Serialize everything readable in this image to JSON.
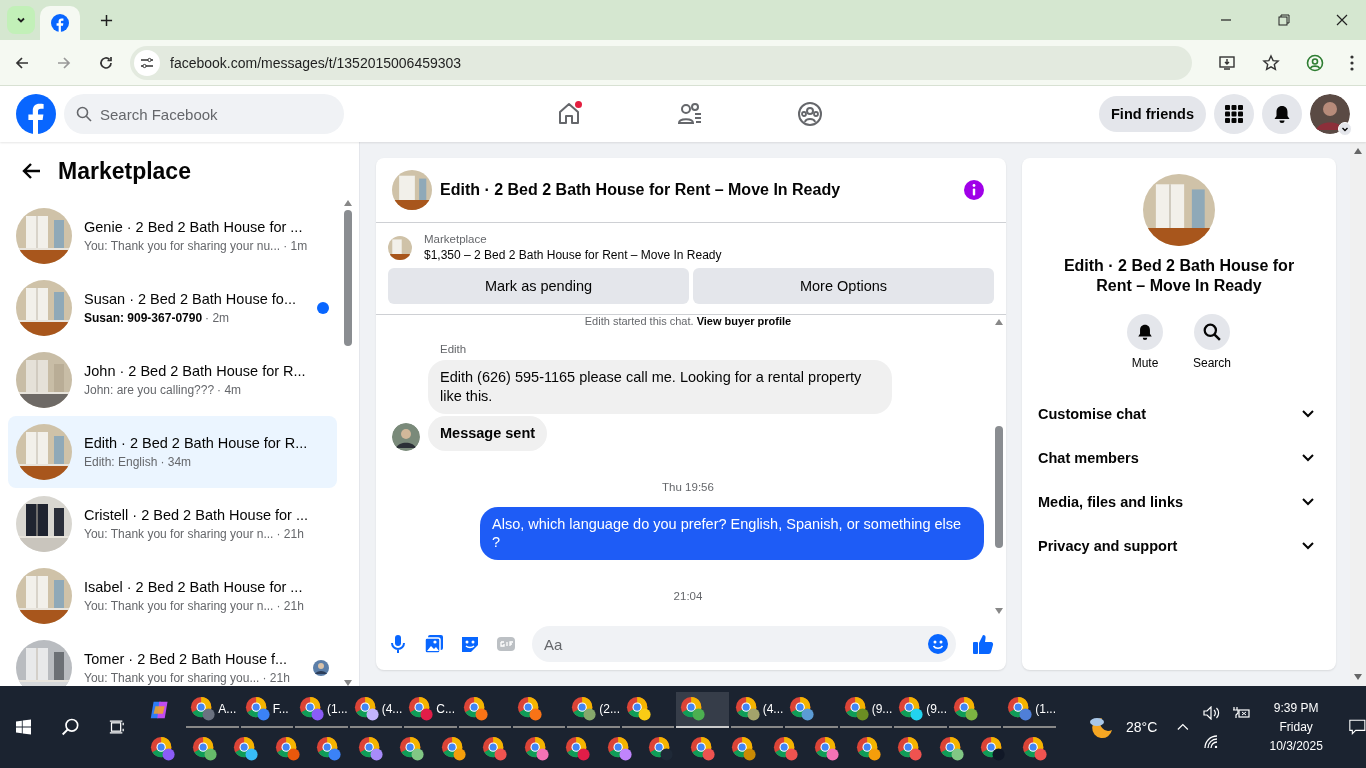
{
  "browser": {
    "address": "facebook.com/messages/t/1352015006459303"
  },
  "header": {
    "search": {
      "placeholder": "Search Facebook"
    },
    "find_friends": "Find friends"
  },
  "sidebar": {
    "title": "Marketplace",
    "conversations": [
      {
        "name": "Genie · 2 Bed 2 Bath House for ...",
        "preview": "You: Thank you for sharing your nu...",
        "time": "· 1m",
        "unread": false,
        "selected": false,
        "seen": false
      },
      {
        "name": "Susan · 2 Bed 2 Bath House fo...",
        "preview": "Susan: 909-367-0790",
        "time": "· 2m",
        "unread": true,
        "selected": false,
        "seen": false
      },
      {
        "name": "John · 2 Bed 2 Bath House for R...",
        "preview": "John: are you calling???",
        "time": "· 4m",
        "unread": false,
        "selected": false,
        "seen": false
      },
      {
        "name": "Edith · 2 Bed 2 Bath House for R...",
        "preview": "Edith: English",
        "time": "· 34m",
        "unread": false,
        "selected": true,
        "seen": false
      },
      {
        "name": "Cristell · 2 Bed 2 Bath House for ...",
        "preview": "You: Thank you for sharing your n...",
        "time": "· 21h",
        "unread": false,
        "selected": false,
        "seen": false
      },
      {
        "name": "Isabel · 2 Bed 2 Bath House for ...",
        "preview": "You: Thank you for sharing your n...",
        "time": "· 21h",
        "unread": false,
        "selected": false,
        "seen": false
      },
      {
        "name": "Tomer · 2 Bed 2 Bath House f...",
        "preview": "You: Thank you for sharing you...",
        "time": "· 21h",
        "unread": false,
        "selected": false,
        "seen": true
      }
    ]
  },
  "chat": {
    "title": "Edith · 2 Bed 2 Bath House for Rent – Move In Ready",
    "listing": {
      "label": "Marketplace",
      "text": "$1,350 – 2 Bed 2 Bath House for Rent – Move In Ready"
    },
    "buttons": [
      "Mark as pending",
      "More Options"
    ],
    "notice": {
      "text": "Edith started this chat.",
      "link": "View buyer profile"
    },
    "messages": [
      {
        "kind": "sender",
        "text": "Edith"
      },
      {
        "kind": "incoming",
        "text": "Edith (626) 595-1165 please call me. Looking for a rental property like this.",
        "bold": false,
        "avatar": false
      },
      {
        "kind": "incoming",
        "text": "Message sent",
        "bold": true,
        "avatar": true
      },
      {
        "kind": "time",
        "text": "Thu 19:56"
      },
      {
        "kind": "outgoing",
        "text": "Also, which language do you prefer? English, Spanish, or something else ?"
      },
      {
        "kind": "time",
        "text": "21:04"
      }
    ],
    "composer": {
      "placeholder": "Aa"
    }
  },
  "info": {
    "title": "Edith · 2 Bed 2 Bath House for Rent – Move In Ready",
    "actions": [
      {
        "kind": "mute",
        "label": "Mute"
      },
      {
        "kind": "search",
        "label": "Search"
      }
    ],
    "sections": [
      {
        "label": "Customise chat",
        "expanded": false
      },
      {
        "label": "Chat members",
        "expanded": false
      },
      {
        "label": "Media, files and links",
        "expanded": false
      },
      {
        "label": "Privacy and support",
        "expanded": false
      }
    ]
  },
  "taskbar": {
    "open_apps": [
      {
        "label": "A...",
        "color": "#6b7280",
        "active": false
      },
      {
        "label": "F...",
        "color": "#3b82f6",
        "active": false
      },
      {
        "label": "(1...",
        "color": "#8b5cf6",
        "active": false
      },
      {
        "label": "(4...",
        "color": "#c4b5fd",
        "active": false
      },
      {
        "label": "C...",
        "color": "#e11d48",
        "active": false
      },
      {
        "color": "#f97316",
        "active": false
      },
      {
        "color": "#f97316",
        "active": false
      },
      {
        "label": "(2...",
        "color": "#86a86b",
        "active": false
      },
      {
        "color": "#facc15",
        "active": false
      },
      {
        "color": "#4caf50",
        "active": true
      },
      {
        "label": "(4...",
        "color": "#a3a36b",
        "active": false
      },
      {
        "color": "#5b9bd5",
        "active": false
      },
      {
        "label": "(9...",
        "color": "#6b8e23",
        "active": false
      },
      {
        "label": "(9...",
        "color": "#22d3ee",
        "active": false
      },
      {
        "color": "#7cb342",
        "active": false
      },
      {
        "label": "(1...",
        "color": "#4f7fd8",
        "active": false
      }
    ],
    "pinned": [
      {
        "color": "#8b5cf6"
      },
      {
        "color": "#66bb6a"
      },
      {
        "color": "#38bdf8"
      },
      {
        "color": "#ea580c"
      },
      {
        "color": "#3b82f6"
      },
      {
        "color": "#a78bfa"
      },
      {
        "color": "#81c784"
      },
      {
        "color": "#f59e0b"
      },
      {
        "color": "#ef5350"
      },
      {
        "color": "#f472b6"
      },
      {
        "color": "#e11d48"
      },
      {
        "color": "#c084fc"
      },
      {
        "color": "#1f2937"
      },
      {
        "color": "#ef5350"
      },
      {
        "color": "#ca8a04"
      },
      {
        "color": "#ef5350"
      },
      {
        "color": "#f472b6"
      },
      {
        "color": "#f59e0b"
      },
      {
        "color": "#ef5350"
      },
      {
        "color": "#81c784"
      },
      {
        "color": "#111827"
      },
      {
        "color": "#ef5350"
      }
    ],
    "weather": "28°C",
    "time": "9:39 PM",
    "day": "Friday",
    "date": "10/3/2025"
  }
}
